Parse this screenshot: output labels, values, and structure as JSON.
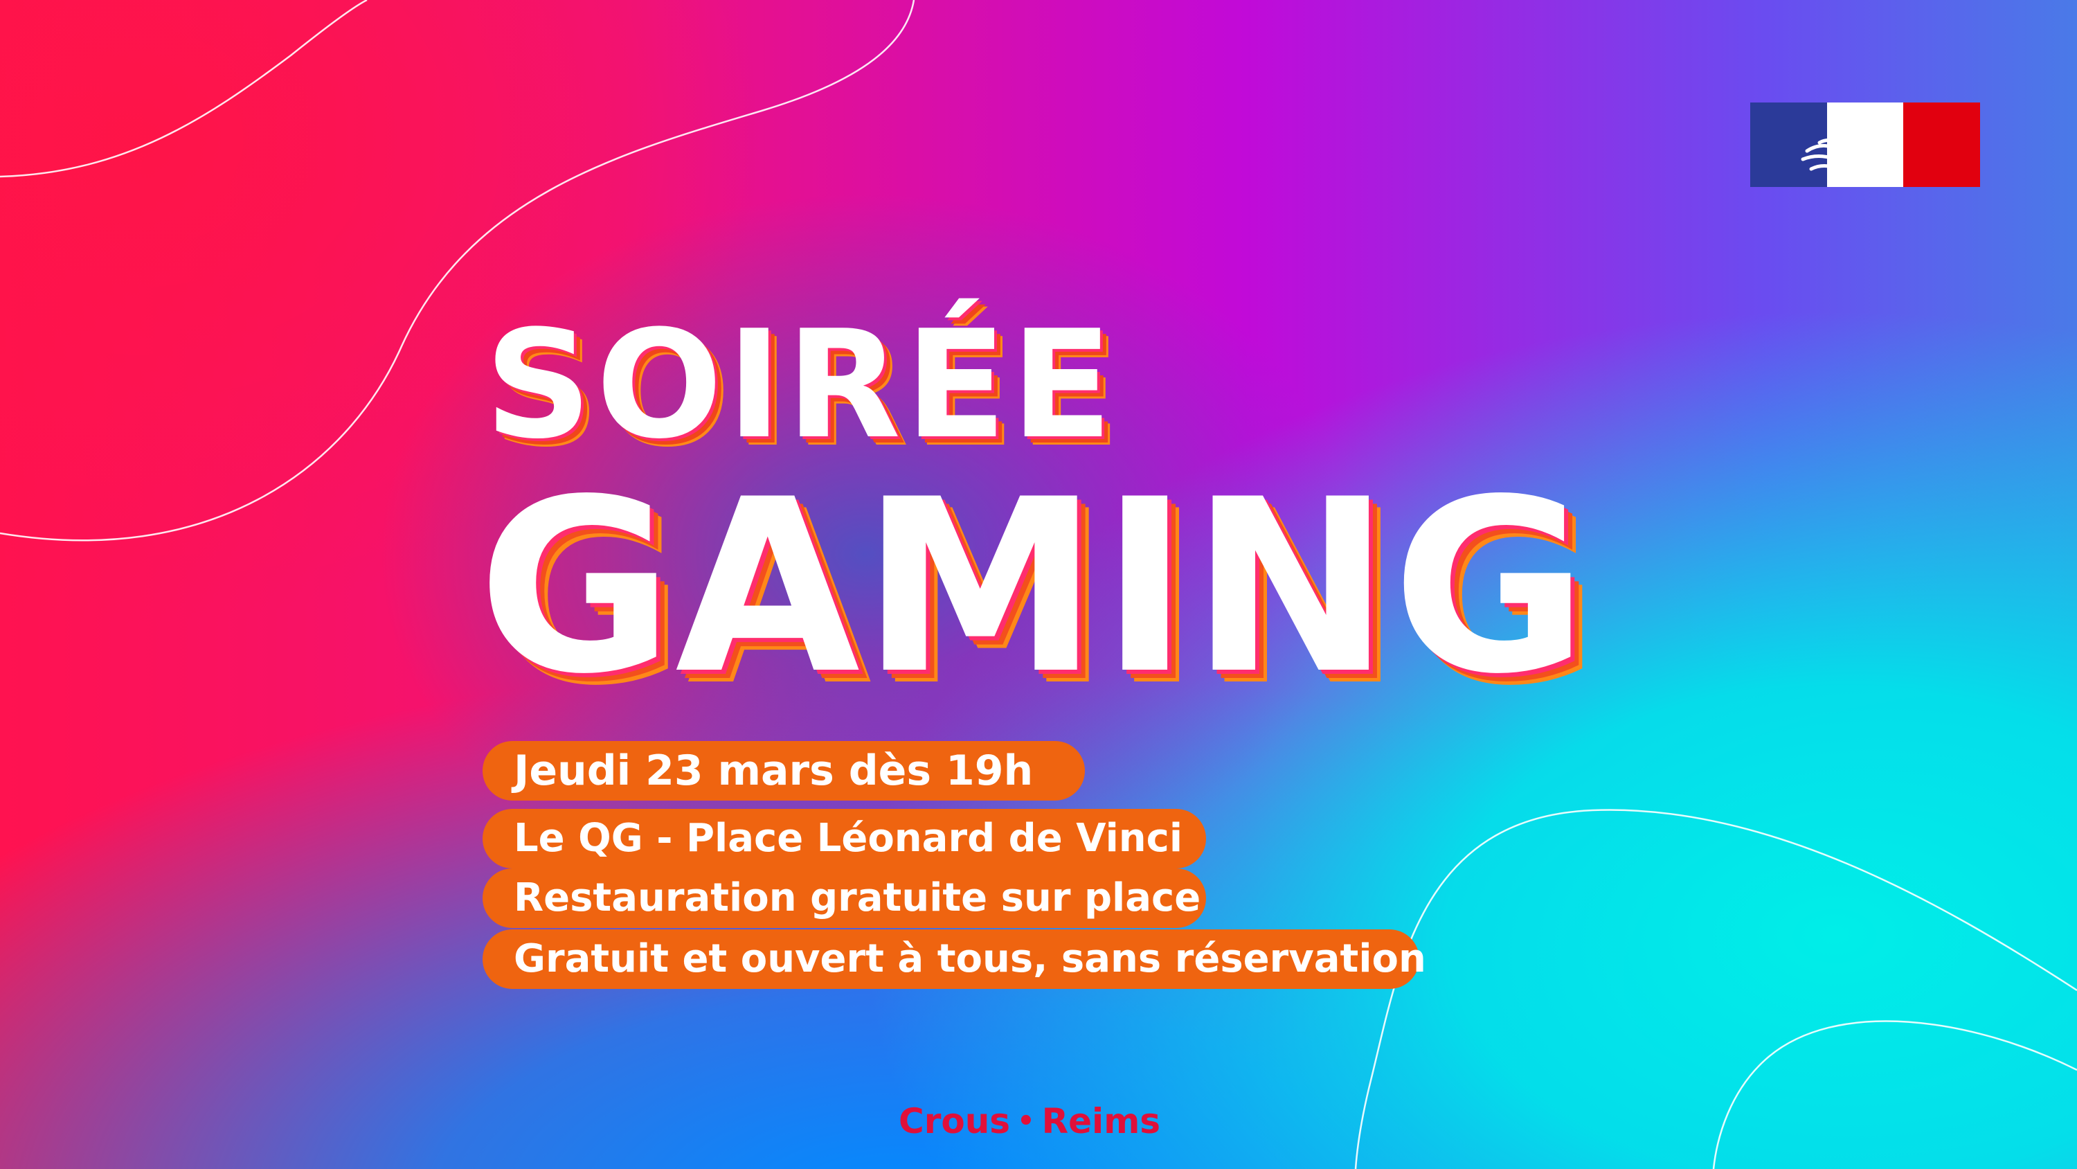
{
  "title": {
    "line1": "SOIRÉE",
    "line2": "GAMING"
  },
  "details": {
    "date": "Jeudi 23 mars dès 19h",
    "location": "Le QG - Place Léonard de Vinci",
    "food": "Restauration gratuite sur place",
    "access": "Gratuit et ouvert à tous, sans réservation"
  },
  "footer": {
    "org_part1": "Crous",
    "separator": "•",
    "org_part2": "Reims"
  },
  "colors": {
    "pill_background": "#ef6410",
    "footer_text": "#e0103a",
    "flag_blue": "#2b3a99",
    "flag_white": "#ffffff",
    "flag_red": "#e1000f"
  },
  "icons": {
    "flag": "republique-francaise-marianne-logo"
  }
}
